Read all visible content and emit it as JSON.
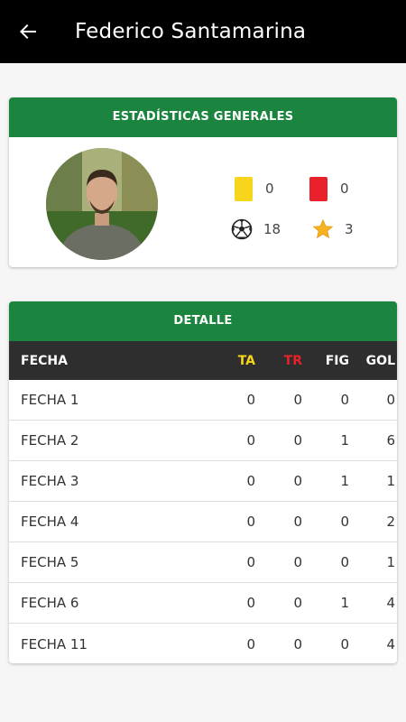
{
  "header": {
    "title": "Federico Santamarina",
    "back_icon": "arrow-left-icon"
  },
  "stats": {
    "title": "ESTADÍSTICAS GENERALES",
    "yellow_cards": "0",
    "red_cards": "0",
    "goals": "18",
    "mvp": "3"
  },
  "detail": {
    "title": "DETALLE",
    "columns": {
      "fecha": "FECHA",
      "ta": "TA",
      "tr": "TR",
      "fig": "FIG",
      "gol": "GOL"
    },
    "rows": [
      {
        "fecha": "FECHA 1",
        "ta": "0",
        "tr": "0",
        "fig": "0",
        "gol": "0"
      },
      {
        "fecha": "FECHA 2",
        "ta": "0",
        "tr": "0",
        "fig": "1",
        "gol": "6"
      },
      {
        "fecha": "FECHA 3",
        "ta": "0",
        "tr": "0",
        "fig": "1",
        "gol": "1"
      },
      {
        "fecha": "FECHA 4",
        "ta": "0",
        "tr": "0",
        "fig": "0",
        "gol": "2"
      },
      {
        "fecha": "FECHA 5",
        "ta": "0",
        "tr": "0",
        "fig": "0",
        "gol": "1"
      },
      {
        "fecha": "FECHA 6",
        "ta": "0",
        "tr": "0",
        "fig": "1",
        "gol": "4"
      },
      {
        "fecha": "FECHA 11",
        "ta": "0",
        "tr": "0",
        "fig": "0",
        "gol": "4"
      }
    ]
  },
  "colors": {
    "appbar": "#000000",
    "header_green": "#1b8540",
    "table_head": "#2e2e2e",
    "yellow": "#f7d51d",
    "red": "#e8212a"
  }
}
